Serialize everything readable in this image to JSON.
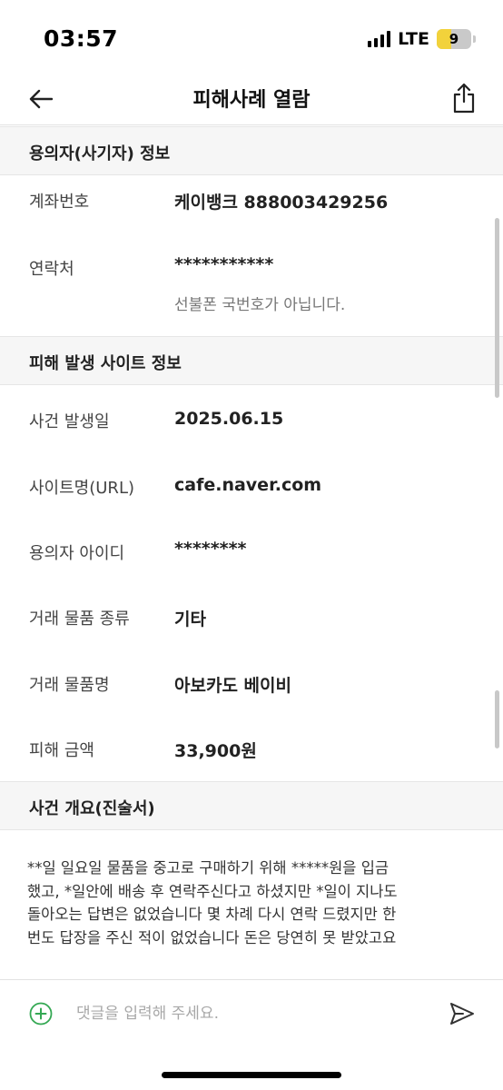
{
  "status_bar": {
    "time": "03:57",
    "network": "LTE",
    "battery": "9"
  },
  "nav": {
    "title": "피해사례 열람"
  },
  "suspect_section": {
    "title": "용의자(사기자) 정보",
    "account_label": "계좌번호",
    "account_value": "케이뱅크 888003429256",
    "contact_label": "연락처",
    "contact_value": "***********",
    "contact_note": "선불폰 국번호가 아닙니다."
  },
  "site_section": {
    "title": "피해 발생 사이트 정보",
    "rows": [
      {
        "label": "사건 발생일",
        "value": "2025.06.15"
      },
      {
        "label": "사이트명(URL)",
        "value": "cafe.naver.com"
      },
      {
        "label": "용의자 아이디",
        "value": "********"
      },
      {
        "label": "거래 물품 종류",
        "value": "기타"
      },
      {
        "label": "거래 물품명",
        "value": "아보카도 베이비"
      },
      {
        "label": "피해 금액",
        "value": "33,900원"
      }
    ]
  },
  "summary_section": {
    "title": "사건 개요(진술서)",
    "lines": [
      "**일 일요일 물품을 중고로 구매하기 위해 *****원을 입금",
      "했고, *일안에 배송 후 연락주신다고 하셨지만 *일이 지나도",
      "돌아오는 답변은 없었습니다 몇 차례 다시 연락 드렸지만 한",
      "번도 답장을 주신 적이 없었습니다 돈은 당연히 못 받았고요"
    ]
  },
  "comment": {
    "placeholder": "댓글을 입력해 주세요."
  },
  "colors": {
    "accent_green": "#34a853",
    "battery_yellow": "#f2d23b"
  },
  "icons": [
    "back-arrow-icon",
    "share-icon",
    "add-circle-icon",
    "send-icon",
    "signal-icon"
  ]
}
